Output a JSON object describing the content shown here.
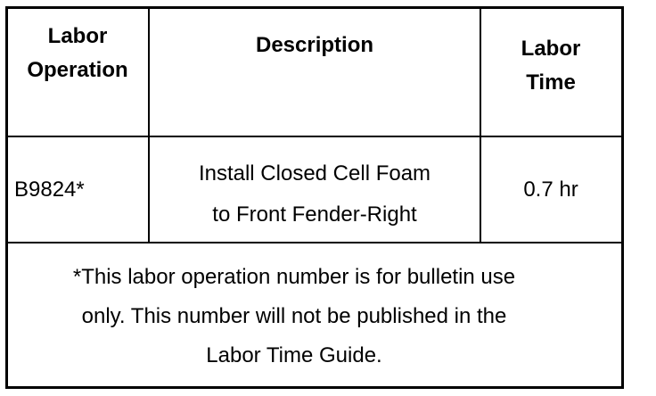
{
  "table": {
    "headers": {
      "labor_operation": "Labor\nOperation",
      "description": "Description",
      "labor_time": "Labor\nTime"
    },
    "row": {
      "labor_operation": "B9824*",
      "description": "Install Closed Cell Foam\nto Front Fender-Right",
      "labor_time": "0.7 hr"
    },
    "footnote": "*This labor operation number is for bulletin use\nonly. This number will not be published in the\nLabor Time Guide."
  }
}
